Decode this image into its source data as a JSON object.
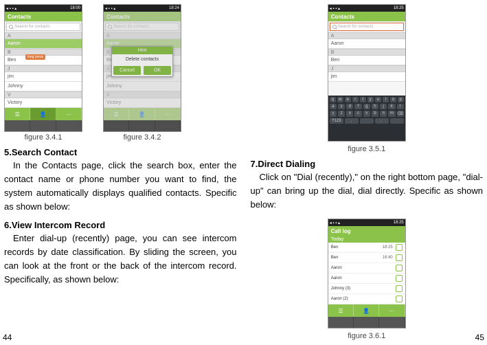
{
  "left": {
    "fig1_caption": "figure 3.4.1",
    "fig2_caption": "figure 3.4.2",
    "h5": "5.Search Contact",
    "p5": "In the Contacts page, click the search box, enter the contact name or phone number you want to find, the system automatically displays qualified contacts. Specific as shown below:",
    "h6": "6.View Intercom Record",
    "p6": "Enter dial-up (recently) page, you can see intercom records by date classification. By sliding the screen, you can look at the front or the back of the intercom record. Specifically, as shown below:",
    "pagenum": "44"
  },
  "right": {
    "fig3_caption": "figure 3.5.1",
    "h7": "7.Direct Dialing",
    "p7": "Click on \"Dial (recently),\" on the right bottom page, \"dial-up\" can bring up the dial, dial directly. Specific as shown below:",
    "fig4_caption": "figure 3.6.1",
    "pagenum": "45"
  },
  "mock": {
    "status_time1": "18:00",
    "status_time2": "18:24",
    "status_time3": "18:25",
    "title_contacts": "Contacts",
    "title_calllog": "Call log",
    "search_ph": "Search for contacts",
    "sections": {
      "A": "A",
      "B": "B",
      "J": "J",
      "V": "V"
    },
    "names": {
      "aaron": "Aaron",
      "ben": "Ben",
      "jim": "jim",
      "johnny": "Johnny",
      "victory": "Victory"
    },
    "dialog_title": "Hint",
    "dialog_body": "Delete contacts",
    "btn_cancel": "Cancel",
    "btn_ok": "OK",
    "today": "Today",
    "calllog_rows": [
      {
        "n": "Ben",
        "t": "18:25"
      },
      {
        "n": "Ben",
        "t": "16:40"
      },
      {
        "n": "Aaron",
        "t": ""
      },
      {
        "n": "Aaron",
        "t": ""
      },
      {
        "n": "Johnny (3)",
        "t": ""
      },
      {
        "n": "Aaron (2)",
        "t": ""
      }
    ],
    "keys_r1": [
      "q",
      "w",
      "e",
      "r",
      "t",
      "y",
      "u",
      "i",
      "o",
      "p"
    ],
    "keys_r2": [
      "a",
      "s",
      "d",
      "f",
      "g",
      "h",
      "j",
      "k",
      "l"
    ],
    "keys_r3": [
      "⇧",
      "z",
      "x",
      "c",
      "v",
      "b",
      "n",
      "m",
      "⌫"
    ],
    "keys_r4": [
      "?123",
      ",",
      "",
      ".",
      " "
    ]
  }
}
